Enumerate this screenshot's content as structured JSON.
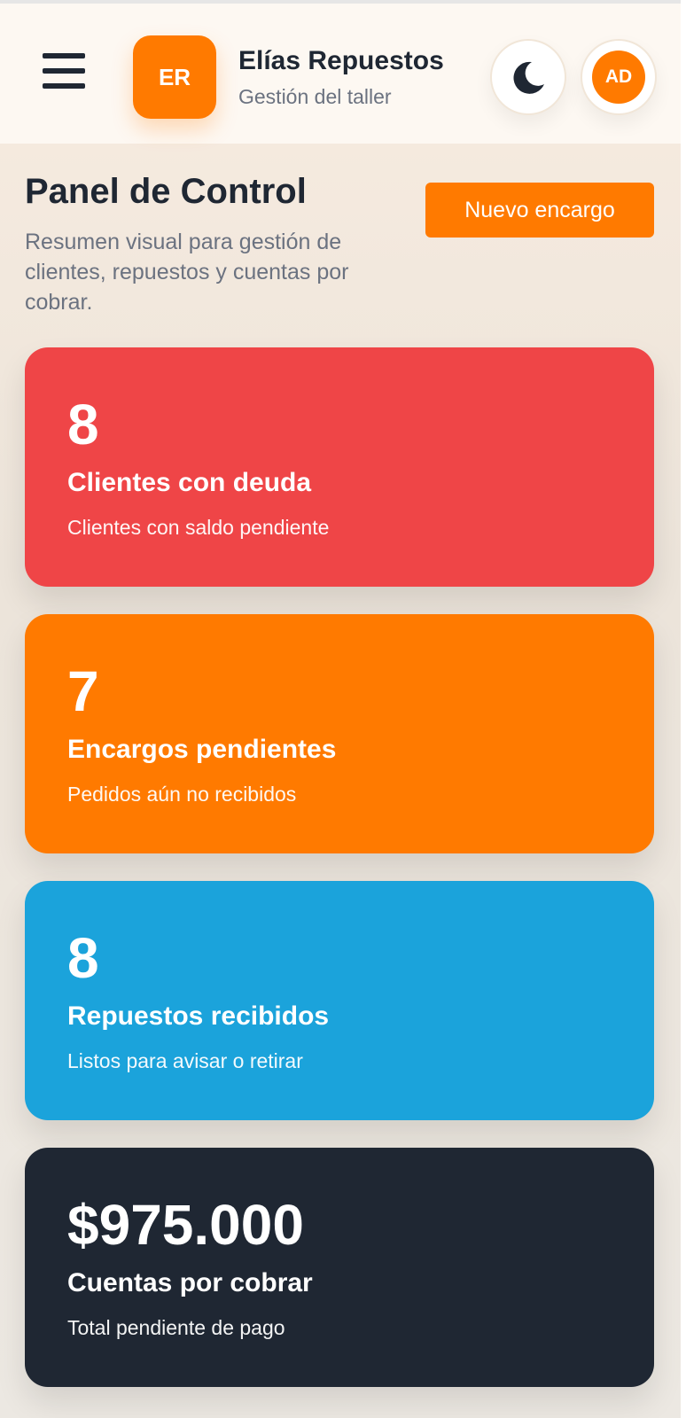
{
  "header": {
    "logo_initials": "ER",
    "brand_name": "Elías Repuestos",
    "brand_subtitle": "Gestión del taller",
    "user_initials": "AD"
  },
  "main": {
    "title": "Panel de Control",
    "description": "Resumen visual para gestión de clientes, repuestos y cuentas por cobrar.",
    "new_button_label": "Nuevo encargo"
  },
  "cards": [
    {
      "value": "8",
      "title": "Clientes con deuda",
      "subtitle": "Clientes con saldo pendiente",
      "color": "#ef4547"
    },
    {
      "value": "7",
      "title": "Encargos pendientes",
      "subtitle": "Pedidos aún no recibidos",
      "color": "#ff7a00"
    },
    {
      "value": "8",
      "title": "Repuestos recibidos",
      "subtitle": "Listos para avisar o retirar",
      "color": "#1ba3db"
    },
    {
      "value": "$975.000",
      "title": "Cuentas por cobrar",
      "subtitle": "Total pendiente de pago",
      "color": "#1f2733"
    }
  ],
  "icons": {
    "menu": "menu-icon",
    "theme": "moon-icon"
  },
  "colors": {
    "accent": "#ff7a00",
    "text_dark": "#1f2733",
    "text_muted": "#6b7280"
  }
}
